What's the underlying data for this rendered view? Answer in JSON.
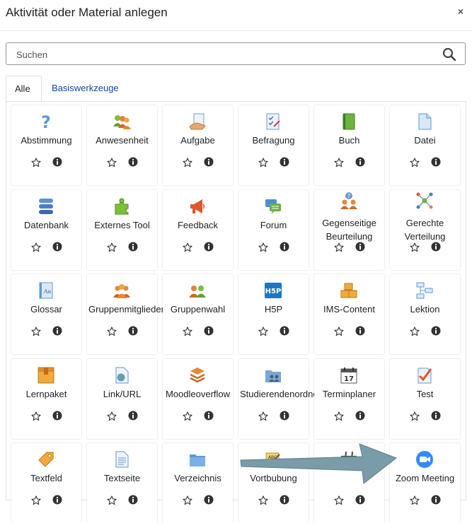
{
  "dialog": {
    "title": "Aktivität oder Material anlegen",
    "close_label": "×"
  },
  "search": {
    "placeholder": "Suchen"
  },
  "tabs": [
    {
      "label": "Alle"
    },
    {
      "label": "Basiswerkzeuge"
    }
  ],
  "items": [
    {
      "label": "Abstimmung",
      "icon": "question-icon"
    },
    {
      "label": "Anwesenheit",
      "icon": "attendance-icon"
    },
    {
      "label": "Aufgabe",
      "icon": "assignment-icon"
    },
    {
      "label": "Befragung",
      "icon": "survey-icon"
    },
    {
      "label": "Buch",
      "icon": "book-icon"
    },
    {
      "label": "Datei",
      "icon": "file-icon"
    },
    {
      "label": "Datenbank",
      "icon": "database-icon"
    },
    {
      "label": "Externes Tool",
      "icon": "puzzle-icon"
    },
    {
      "label": "Feedback",
      "icon": "megaphone-icon"
    },
    {
      "label": "Forum",
      "icon": "forum-icon"
    },
    {
      "label": "Gegenseitige Beurteilung",
      "icon": "workshop-icon"
    },
    {
      "label": "Gerechte Verteilung",
      "icon": "ratingallocate-icon"
    },
    {
      "label": "Glossar",
      "icon": "glossary-icon"
    },
    {
      "label": "Gruppenmitglieder",
      "icon": "group-members-icon"
    },
    {
      "label": "Gruppenwahl",
      "icon": "group-choice-icon"
    },
    {
      "label": "H5P",
      "icon": "h5p-icon"
    },
    {
      "label": "IMS-Content",
      "icon": "ims-package-icon"
    },
    {
      "label": "Lektion",
      "icon": "lesson-icon"
    },
    {
      "label": "Lernpaket",
      "icon": "scorm-package-icon"
    },
    {
      "label": "Link/URL",
      "icon": "url-icon"
    },
    {
      "label": "Moodleoverflow",
      "icon": "moodleoverflow-icon"
    },
    {
      "label": "Studierendenordner",
      "icon": "student-folder-icon"
    },
    {
      "label": "Terminplaner",
      "icon": "calendar-icon"
    },
    {
      "label": "Test",
      "icon": "quiz-icon"
    },
    {
      "label": "Textfeld",
      "icon": "label-tag-icon"
    },
    {
      "label": "Textseite",
      "icon": "page-icon"
    },
    {
      "label": "Verzeichnis",
      "icon": "folder-icon"
    },
    {
      "label": "Vortbubung",
      "icon": "vocabulary-icon"
    },
    {
      "label": "",
      "icon": "hashtag-icon"
    },
    {
      "label": "Zoom Meeting",
      "icon": "zoom-icon"
    }
  ],
  "colors": {
    "accent": "#0f47ad",
    "arrow": "#7a9ba8"
  }
}
